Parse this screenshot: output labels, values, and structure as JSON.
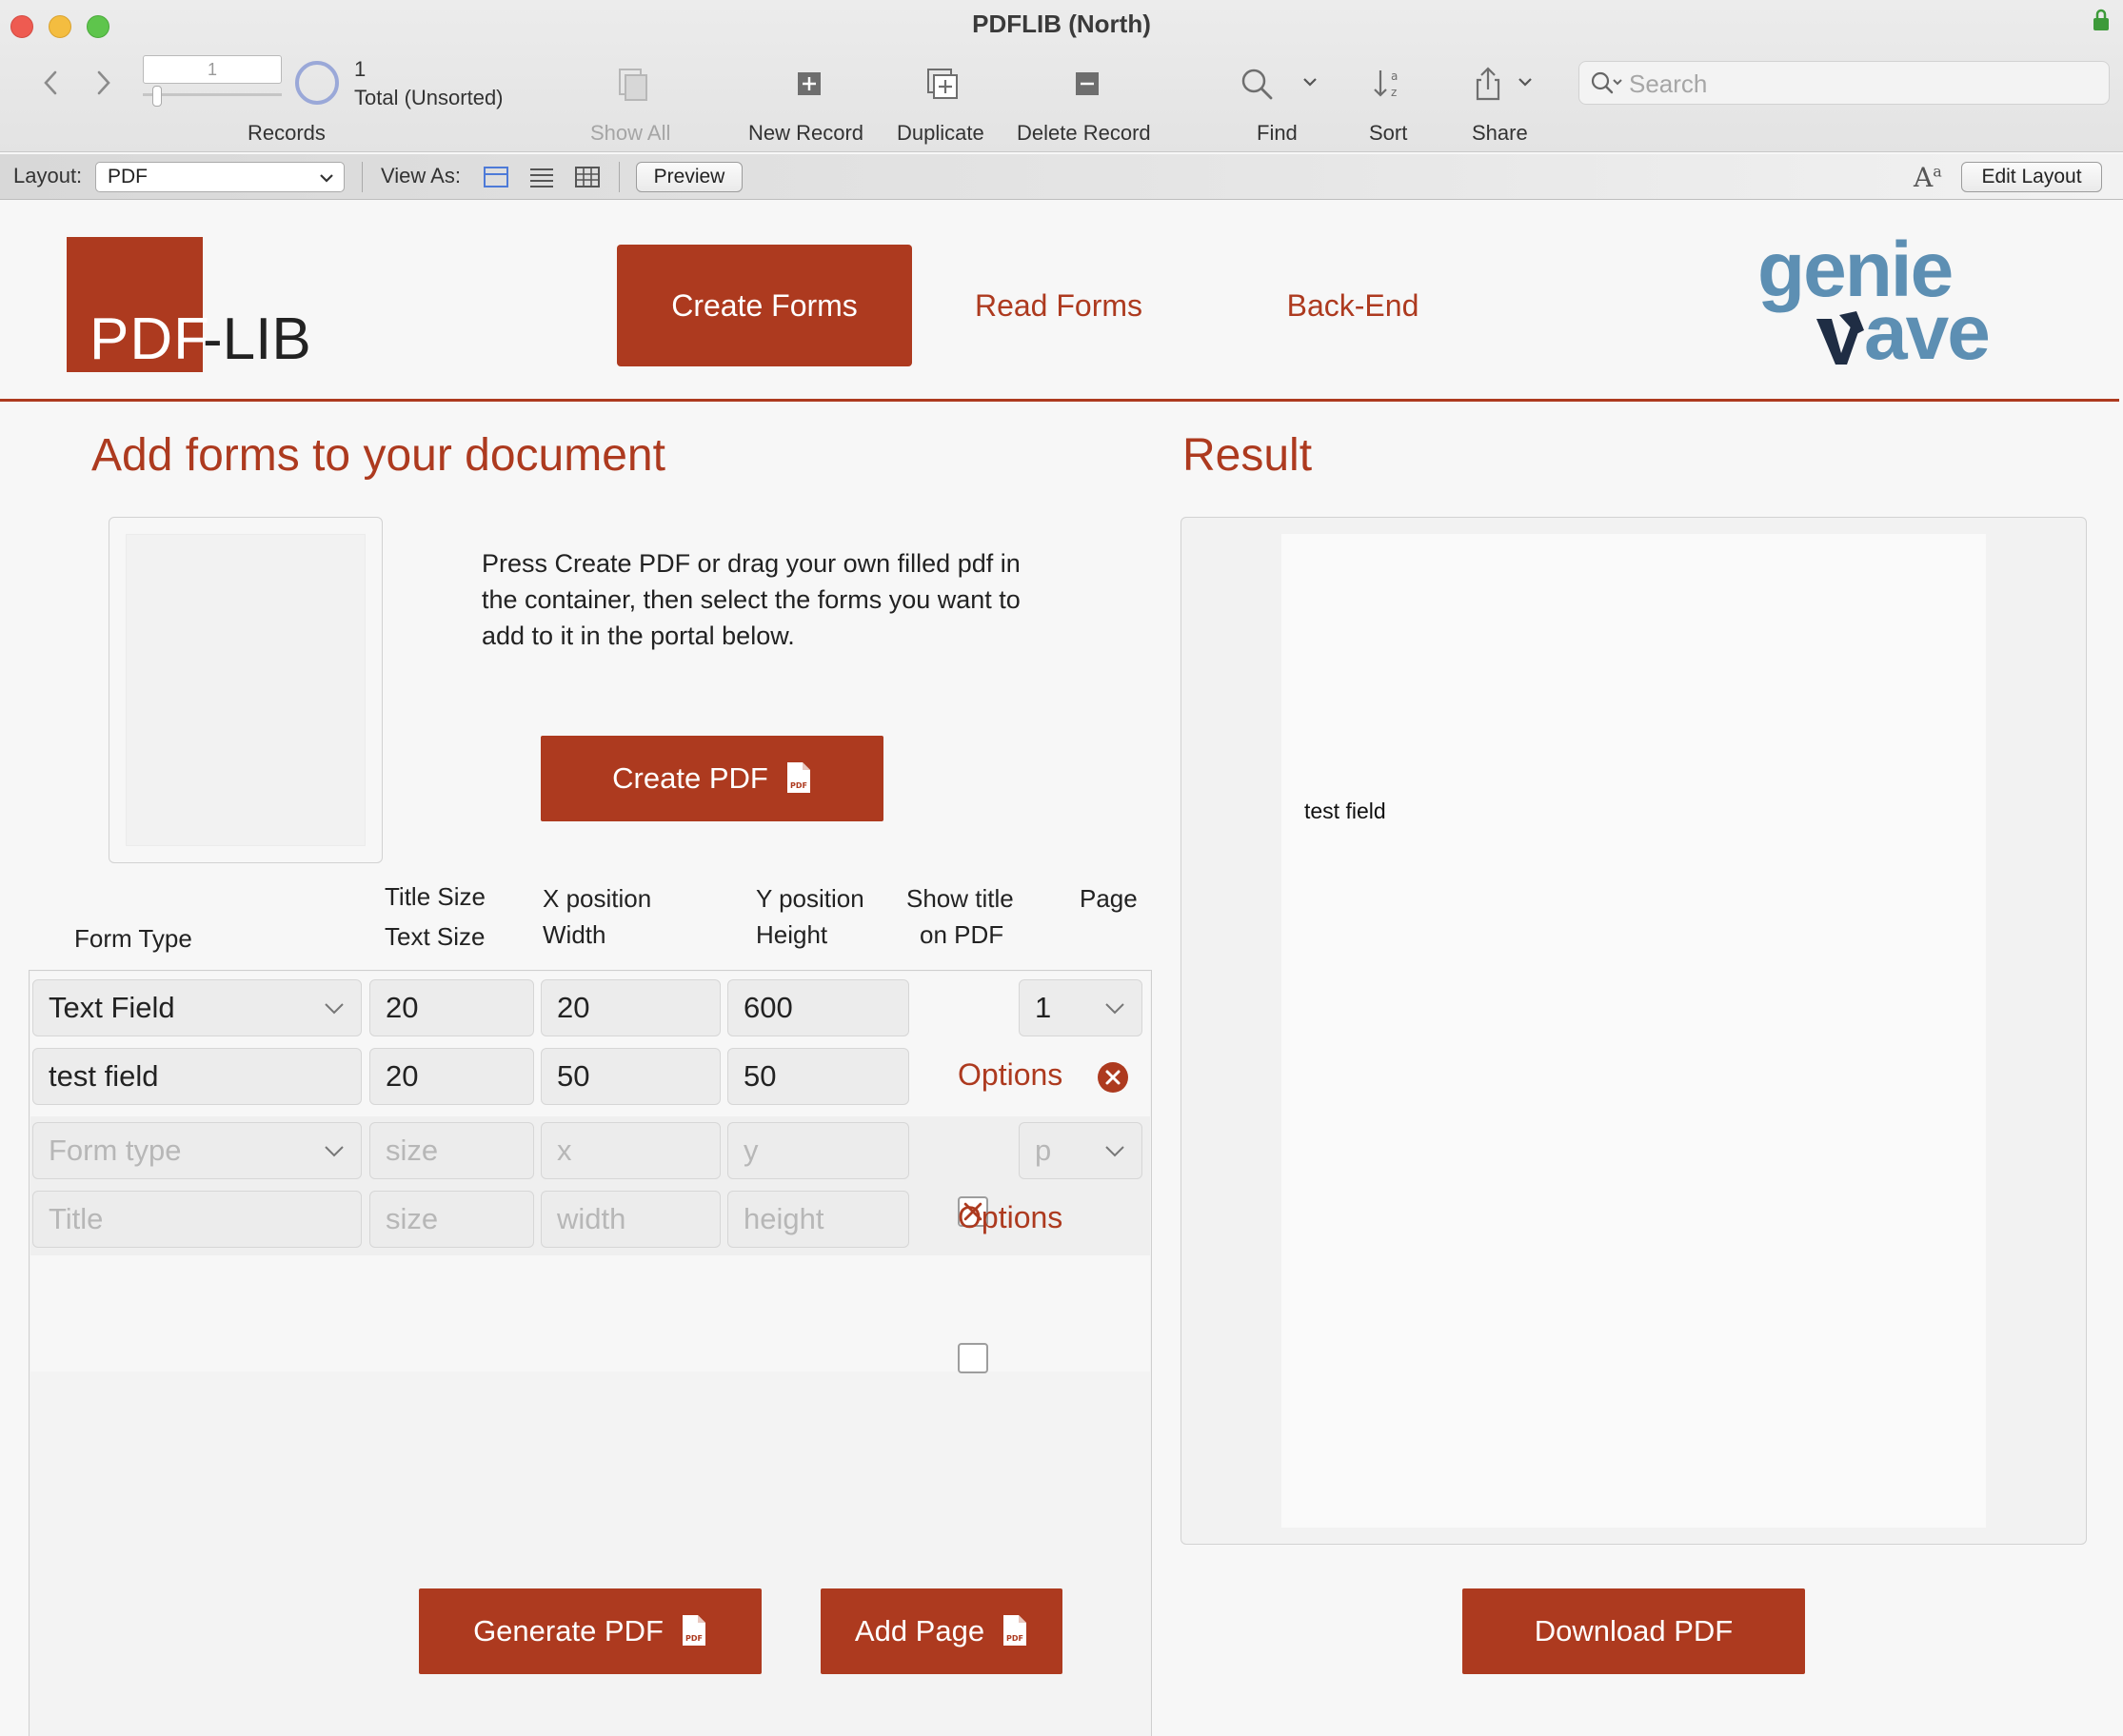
{
  "window": {
    "title": "PDFLIB (North)"
  },
  "toolbar": {
    "record_number": "1",
    "record_count": "1",
    "record_total": "Total (Unsorted)",
    "records_label": "Records",
    "show_all_label": "Show All",
    "new_record_label": "New Record",
    "duplicate_label": "Duplicate",
    "delete_record_label": "Delete Record",
    "find_label": "Find",
    "sort_label": "Sort",
    "share_label": "Share",
    "search_placeholder": "Search"
  },
  "layout_bar": {
    "layout_label": "Layout:",
    "layout_value": "PDF",
    "view_as_label": "View As:",
    "preview_label": "Preview",
    "edit_layout_label": "Edit Layout"
  },
  "header": {
    "logo_pdf": "PDF",
    "logo_lib": "-LIB",
    "tabs": [
      {
        "label": "Create Forms",
        "active": true
      },
      {
        "label": "Read Forms",
        "active": false
      },
      {
        "label": "Back-End",
        "active": false
      }
    ],
    "brand_logo": {
      "line1": "genie",
      "line2": "ave"
    }
  },
  "left": {
    "title": "Add forms to your document",
    "instructions": "Press Create PDF or drag your own filled pdf in the container, then select the forms you want to add to it in the portal below.",
    "create_pdf_label": "Create PDF",
    "columns": {
      "form_type": "Form Type",
      "title_size": "Title Size",
      "text_size": "Text Size",
      "x_position": "X position",
      "width": "Width",
      "y_position": "Y position",
      "height": "Height",
      "show_title_1": "Show title",
      "show_title_2": "on PDF",
      "page": "Page"
    },
    "rows": [
      {
        "form_type": "Text Field",
        "title_size": "20",
        "x": "20",
        "y": "600",
        "show_title": true,
        "page": "1",
        "title": "test field",
        "text_size": "20",
        "width": "50",
        "height": "50",
        "options_label": "Options"
      }
    ],
    "new_row": {
      "form_type_ph": "Form type",
      "title_size_ph": "size",
      "x_ph": "x",
      "y_ph": "y",
      "page_ph": "p",
      "title_ph": "Title",
      "text_size_ph": "size",
      "width_ph": "width",
      "height_ph": "height",
      "options_label": "Options"
    },
    "generate_pdf_label": "Generate PDF",
    "add_page_label": "Add Page"
  },
  "right": {
    "title": "Result",
    "preview_text": "test field",
    "download_pdf_label": "Download PDF"
  },
  "colors": {
    "accent": "#ad3a1f",
    "brand_blue": "#5d8fb3",
    "brand_navy": "#1f2d44"
  },
  "icons": {
    "pdf_file": "pdf-file-icon",
    "delete": "circle-x-icon"
  }
}
